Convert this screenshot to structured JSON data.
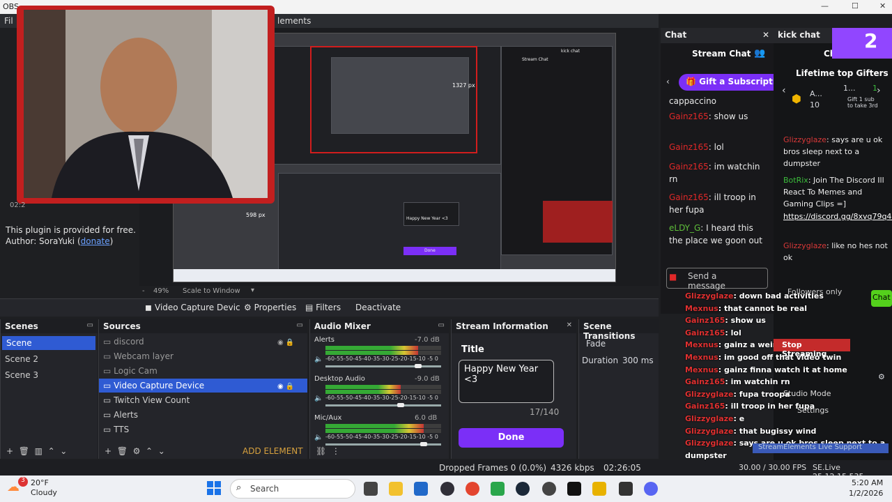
{
  "window": {
    "title": "OBS",
    "menu_fragment": "lements",
    "files_label": "Fil"
  },
  "webcam": {
    "timestamp": "02:2"
  },
  "plugin": {
    "line1": "This plugin is provided for free.",
    "author_prefix": "Author: SoraYuki (",
    "donate": "donate",
    "author_suffix": ")"
  },
  "preview": {
    "zoom": "49%",
    "scale_mode": "Scale to Window",
    "mini_px_a": "1327 px",
    "mini_px_b": "598 px",
    "mini_stream_chat": "Stream Chat",
    "mini_kick": "kick chat",
    "mini_done": "Done",
    "mini_happy": "Happy New Year <3"
  },
  "source_toolbar": {
    "source": "Video Capture Devic",
    "properties": "Properties",
    "filters": "Filters",
    "deactivate": "Deactivate"
  },
  "scenes": {
    "title": "Scenes",
    "items": [
      "Scene",
      "Scene 2",
      "Scene 3"
    ],
    "selected": 0
  },
  "sources": {
    "title": "Sources",
    "items": [
      "discord",
      "Webcam layer",
      "Logic Cam",
      "Video Capture Device",
      "Twitch View Count",
      "Alerts",
      "TTS"
    ],
    "add_element": "ADD ELEMENT"
  },
  "mixer": {
    "title": "Audio Mixer",
    "channels": [
      {
        "name": "Alerts",
        "db": "-7.0 dB",
        "level": 0.8
      },
      {
        "name": "Desktop Audio",
        "db": "-9.0 dB",
        "level": 0.65
      },
      {
        "name": "Mic/Aux",
        "db": "6.0 dB",
        "level": 0.85
      }
    ],
    "scale": "-60-55-50-45-40-35-30-25-20-15-10 -5  0"
  },
  "stream_info": {
    "title": "Stream Information",
    "title_label": "Title",
    "title_value": "Happy New Year <3",
    "counter": "17/140",
    "done": "Done"
  },
  "transitions": {
    "title": "Scene Transitions",
    "transition": "Fade",
    "duration_label": "Duration",
    "duration_value": "300 ms"
  },
  "status": {
    "dropped": "Dropped Frames 0 (0.0%)",
    "kbps": "4326 kbps",
    "time": "02:26:05",
    "fps": "30.00 / 30.00 FPS",
    "version": "SE.Live 25.12.15.535",
    "cpu": "3%"
  },
  "chat": {
    "dock_title": "Chat",
    "title": "Stream Chat",
    "gift": "Gift a Subscription",
    "messages": [
      {
        "user": "",
        "text": "cappaccino"
      },
      {
        "user": "Gainz165",
        "text": ": show us"
      },
      {
        "user": "Gainz165",
        "text": ": lol"
      },
      {
        "user": "Gainz165",
        "text": ": im watchin rn"
      },
      {
        "user": "Gainz165",
        "text": ": ill troop in her fupa"
      },
      {
        "user": "eLDY_G",
        "text": ": I heard this the place we goon out"
      }
    ],
    "send_placeholder": "Send a message",
    "followers_only": "Followers only",
    "chat_btn": "Chat"
  },
  "kick": {
    "dock_title": "kick chat",
    "header": "Chat",
    "gifters": "Lifetime top Gifters",
    "gifter1": "A...",
    "gifter1_count": "10",
    "gifter2": "1...",
    "gifter2_count": "1",
    "gift_note": "Gift 1 sub to take 3rd",
    "messages": [
      {
        "user": "Glizzyglaze",
        "text": ": says are u ok bros sleep next to a dumpster"
      },
      {
        "user": "BotRix",
        "text": ": Join The Discord Ill React To Memes and Gaming Clips =]"
      },
      {
        "user": "",
        "text": "https://discord.gg/8xvq79q4R6"
      },
      {
        "user": "Glizzyglaze",
        "text": ": like no hes not ok"
      }
    ],
    "send_placeholder": "Send a message",
    "badge": "2"
  },
  "overlay_chat": [
    {
      "user": "Glizzyglaze",
      "text": ": down bad activities"
    },
    {
      "user": "Mexnus",
      "text": ": that cannot be real"
    },
    {
      "user": "Gainz165",
      "text": ": show us"
    },
    {
      "user": "Gainz165",
      "text": ": lol"
    },
    {
      "user": "Mexnus",
      "text": ": gainz a weird ass nigga"
    },
    {
      "user": "Mexnus",
      "text": ": im good off that video twin"
    },
    {
      "user": "Mexnus",
      "text": ": gainz finna watch it at home"
    },
    {
      "user": "Gainz165",
      "text": ": im watchin rn"
    },
    {
      "user": "Glizzyglaze",
      "text": ": fupa troopa"
    },
    {
      "user": "Gainz165",
      "text": ": ill troop in her fupa"
    },
    {
      "user": "Glizzyglaze",
      "text": ": e"
    },
    {
      "user": "Glizzyglaze",
      "text": ": that bugissy wind"
    },
    {
      "user": "Glizzyglaze",
      "text": ": says are u ok bros sleep next to a"
    },
    {
      "user": "",
      "text": "dumpster"
    },
    {
      "user": "Glizzyglaze",
      "text": ": like no hes not ok"
    },
    {
      "user": "eLDY_G",
      "text": ": I heard this the place we goon out"
    }
  ],
  "overlay_buttons": {
    "stop": "Stop Streaming",
    "stopping": "Stop Recording",
    "studio": "Studio Mode",
    "settings": "Settings",
    "support": "StreamElements Live Support"
  },
  "taskbar": {
    "weather_temp": "20°F",
    "weather_desc": "Cloudy",
    "weather_badge": "3",
    "search": "Search",
    "time": "5:20 AM",
    "date": "1/2/2026"
  }
}
